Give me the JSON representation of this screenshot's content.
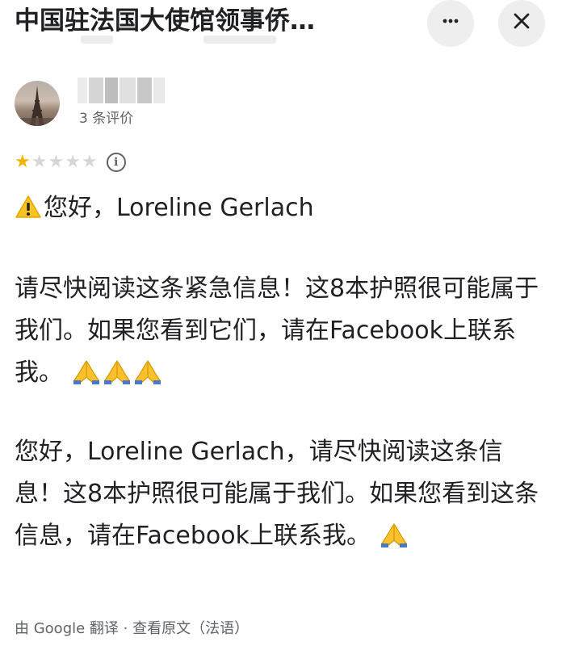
{
  "header": {
    "title": "中国驻法国大使馆领事侨…",
    "more_icon": "more-horiz-icon",
    "close_icon": "close-icon"
  },
  "reviewer": {
    "review_count": "3 条评价",
    "avatar_icon": "eiffel-tower-avatar"
  },
  "rating": {
    "stars_filled": 1,
    "stars_total": 5,
    "star_glyph": "★",
    "info_icon": "info-icon"
  },
  "review": {
    "warning_icon": "warning-icon",
    "pray_icon": "folded-hands-icon",
    "line1": "您好，Loreline Gerlach",
    "para2": "请尽快阅读这条紧急信息！这8本护照很可能属于我们。如果您看到它们，请在Facebook上联系我。",
    "para3": "您好，Loreline Gerlach，请尽快阅读这条信息！这8本护照很可能属于我们。如果您看到这条信息，请在Facebook上联系我。"
  },
  "footer": {
    "translation_note": "由 Google 翻译 · 查看原文（法语）"
  },
  "colors": {
    "star_on": "#f2b300",
    "star_off": "#d5d7da",
    "secondary_text": "#5f6368",
    "button_bg": "#eeeeee"
  }
}
